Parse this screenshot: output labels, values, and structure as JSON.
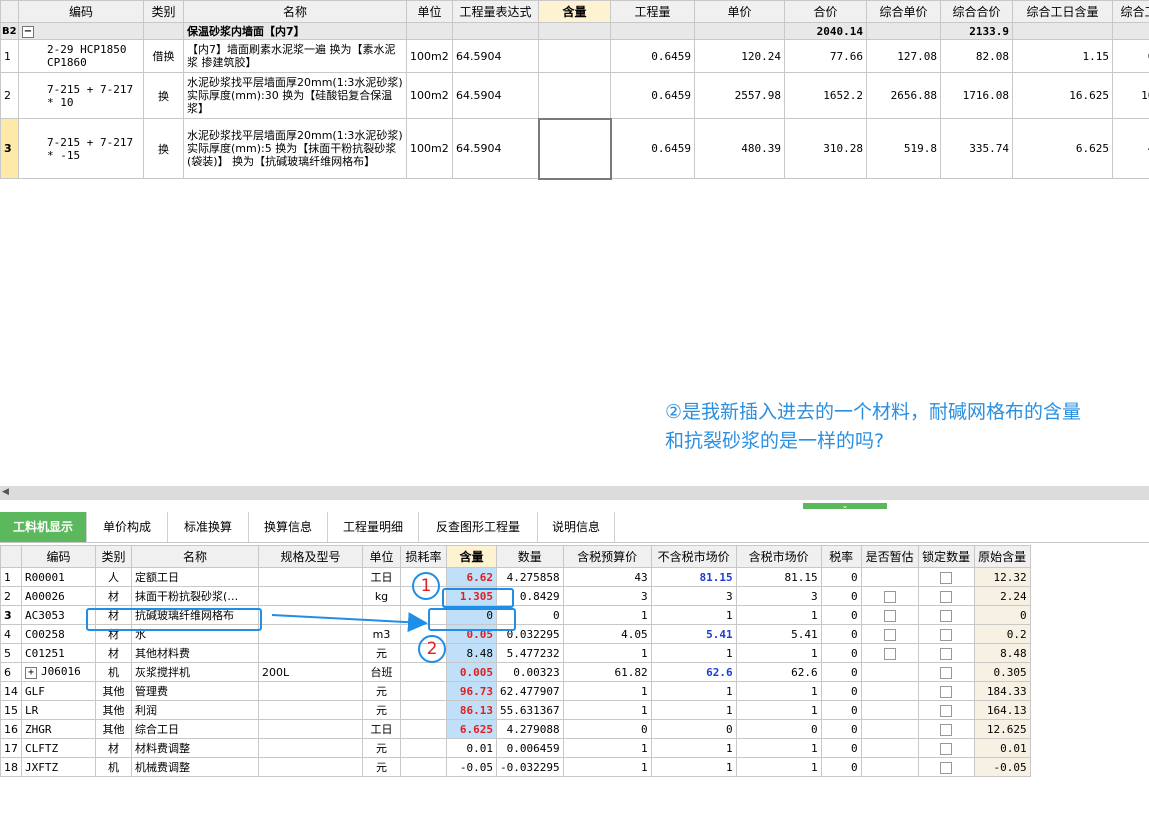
{
  "top": {
    "headers": [
      "编码",
      "类别",
      "名称",
      "单位",
      "工程量表达式",
      "含量",
      "工程量",
      "单价",
      "合价",
      "综合单价",
      "综合合价",
      "综合工日含量",
      "综合工"
    ],
    "group": {
      "row_no": "B2",
      "toggle": "−",
      "name": "保温砂浆内墙面【内7】",
      "hejia": "2040.14",
      "zonghe_hejia": "2133.9"
    },
    "rows": [
      {
        "no": "1",
        "code": "2-29 HCP1850 CP1860",
        "type": "借换",
        "name": "【内7】墙面刷素水泥浆一遍  换为【素水泥浆 掺建筑胶】",
        "unit": "100m2",
        "expr": "64.5904",
        "qty": "",
        "gcl": "0.6459",
        "price": "120.24",
        "hejia": "77.66",
        "zdj": "127.08",
        "zhj": "82.08",
        "gr": "1.15",
        "gr2": "0."
      },
      {
        "no": "2",
        "code": "7-215 + 7-217 * 10",
        "type": "换",
        "name": "水泥砂浆找平层墙面厚20mm(1:3水泥砂浆)  实际厚度(mm):30  换为【硅酸铝复合保温浆】",
        "unit": "100m2",
        "expr": "64.5904",
        "qty": "",
        "gcl": "0.6459",
        "price": "2557.98",
        "hejia": "1652.2",
        "zdj": "2656.88",
        "zhj": "1716.08",
        "gr": "16.625",
        "gr2": "10."
      },
      {
        "no": "3",
        "code": "7-215 + 7-217 * -15",
        "type": "换",
        "name": "水泥砂浆找平层墙面厚20mm(1:3水泥砂浆)  实际厚度(mm):5  换为【抹面干粉抗裂砂浆(袋装)】  换为【抗碱玻璃纤维网格布】",
        "unit": "100m2",
        "expr": "64.5904",
        "qty": "",
        "gcl": "0.6459",
        "price": "480.39",
        "hejia": "310.28",
        "zdj": "519.8",
        "zhj": "335.74",
        "gr": "6.625",
        "gr2": "4."
      }
    ]
  },
  "note": {
    "line1": "②是我新插入进去的一个材料，耐碱网格布的含量",
    "line2": "和抗裂砂浆的是一样的吗?"
  },
  "tabs": [
    "工料机显示",
    "单价构成",
    "标准换算",
    "换算信息",
    "工程量明细",
    "反查图形工程量",
    "说明信息"
  ],
  "bottom": {
    "headers": [
      "",
      "编码",
      "类别",
      "名称",
      "规格及型号",
      "单位",
      "损耗率",
      "含量",
      "数量",
      "含税预算价",
      "不含税市场价",
      "含税市场价",
      "税率",
      "是否暂估",
      "锁定数量",
      "原始含量"
    ],
    "rows": [
      {
        "no": "1",
        "code": "R00001",
        "type": "人",
        "name": "定额工日",
        "spec": "",
        "unit": "工日",
        "loss": "",
        "qty": "6.62",
        "amount": "4.275858",
        "p1": "43",
        "p2": "81.15",
        "p3": "81.15",
        "tax": "0",
        "est": false,
        "lock": true,
        "orig": "12.32"
      },
      {
        "no": "2",
        "code": "A00026",
        "type": "材",
        "name": "抹面干粉抗裂砂浆(…",
        "spec": "",
        "unit": "kg",
        "loss": "",
        "qty": "1.305",
        "amount": "0.8429",
        "p1": "3",
        "p2": "3",
        "p3": "3",
        "tax": "0",
        "est": true,
        "lock": true,
        "orig": "2.24"
      },
      {
        "no": "3",
        "code": "AC3053",
        "type": "材",
        "name": "抗碱玻璃纤维网格布",
        "spec": "",
        "unit": "",
        "loss": "",
        "qty": "0",
        "amount": "0",
        "p1": "1",
        "p2": "1",
        "p3": "1",
        "tax": "0",
        "est": true,
        "lock": true,
        "orig": "0"
      },
      {
        "no": "4",
        "code": "C00258",
        "type": "材",
        "name": "水",
        "spec": "",
        "unit": "m3",
        "loss": "",
        "qty": "0.05",
        "amount": "0.032295",
        "p1": "4.05",
        "p2": "5.41",
        "p3": "5.41",
        "tax": "0",
        "est": true,
        "lock": true,
        "orig": "0.2"
      },
      {
        "no": "5",
        "code": "C01251",
        "type": "材",
        "name": "其他材料费",
        "spec": "",
        "unit": "元",
        "loss": "",
        "qty": "8.48",
        "amount": "5.477232",
        "p1": "1",
        "p2": "1",
        "p3": "1",
        "tax": "0",
        "est": true,
        "lock": true,
        "orig": "8.48"
      },
      {
        "no": "6",
        "code": "J06016",
        "type": "机",
        "name": "灰浆搅拌机",
        "spec": "200L",
        "unit": "台班",
        "loss": "",
        "qty": "0.005",
        "amount": "0.00323",
        "p1": "61.82",
        "p2": "62.6",
        "p3": "62.6",
        "tax": "0",
        "est": false,
        "lock": true,
        "orig": "0.305"
      },
      {
        "no": "14",
        "code": "GLF",
        "type": "其他",
        "name": "管理费",
        "spec": "",
        "unit": "元",
        "loss": "",
        "qty": "96.73",
        "amount": "62.477907",
        "p1": "1",
        "p2": "1",
        "p3": "1",
        "tax": "0",
        "est": false,
        "lock": true,
        "orig": "184.33"
      },
      {
        "no": "15",
        "code": "LR",
        "type": "其他",
        "name": "利润",
        "spec": "",
        "unit": "元",
        "loss": "",
        "qty": "86.13",
        "amount": "55.631367",
        "p1": "1",
        "p2": "1",
        "p3": "1",
        "tax": "0",
        "est": false,
        "lock": true,
        "orig": "164.13"
      },
      {
        "no": "16",
        "code": "ZHGR",
        "type": "其他",
        "name": "综合工日",
        "spec": "",
        "unit": "工日",
        "loss": "",
        "qty": "6.625",
        "amount": "4.279088",
        "p1": "0",
        "p2": "0",
        "p3": "0",
        "tax": "0",
        "est": false,
        "lock": true,
        "orig": "12.625"
      },
      {
        "no": "17",
        "code": "CLFTZ",
        "type": "材",
        "name": "材料费调整",
        "spec": "",
        "unit": "元",
        "loss": "",
        "qty": "0.01",
        "amount": "0.006459",
        "p1": "1",
        "p2": "1",
        "p3": "1",
        "tax": "0",
        "est": false,
        "lock": true,
        "orig": "0.01"
      },
      {
        "no": "18",
        "code": "JXFTZ",
        "type": "机",
        "name": "机械费调整",
        "spec": "",
        "unit": "元",
        "loss": "",
        "qty": "-0.05",
        "amount": "-0.032295",
        "p1": "1",
        "p2": "1",
        "p3": "1",
        "tax": "0",
        "est": false,
        "lock": true,
        "orig": "-0.05"
      }
    ]
  },
  "markers": {
    "m1": "1",
    "m2": "2"
  },
  "colors": {
    "tab_active": "#5cb85c",
    "annotation": "#2b8fe0",
    "qty_bg": "#bfe0f8",
    "red": "#e02020",
    "blue": "#1a3fd0"
  }
}
